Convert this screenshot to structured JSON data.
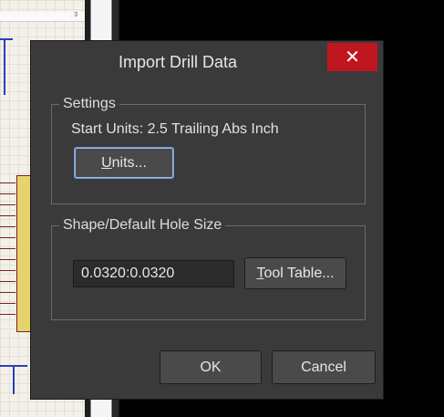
{
  "background": {
    "sheet_number": "3"
  },
  "dialog": {
    "title": "Import Drill Data",
    "close_glyph": "✕",
    "settings": {
      "group_label": "Settings",
      "start_units_text": "Start Units: 2.5 Trailing Abs Inch",
      "units_button_mnemonic": "U",
      "units_button_rest": "nits..."
    },
    "shape": {
      "group_label": "Shape/Default Hole Size",
      "hole_size_value": "0.0320:0.0320",
      "tool_table_mnemonic": "T",
      "tool_table_rest": "ool Table..."
    },
    "ok_label": "OK",
    "cancel_label": "Cancel"
  },
  "colors": {
    "dialog_bg": "#3a3a3a",
    "close_red": "#c0161f",
    "focus_blue": "#6d9ad3"
  }
}
